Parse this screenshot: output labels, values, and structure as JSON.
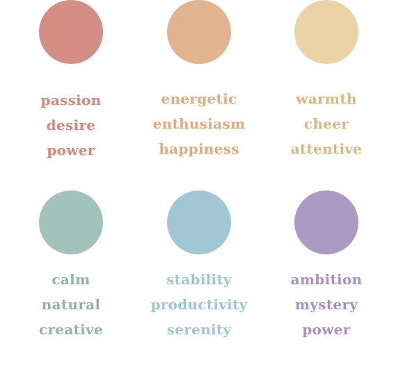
{
  "swatches": [
    {
      "color": "#d48e84",
      "text_color": "#dc8576",
      "words": [
        "passion",
        "desire",
        "power"
      ]
    },
    {
      "color": "#e0b48e",
      "text_color": "#e2aa7c",
      "words": [
        "energetic",
        "enthusiasm",
        "happiness"
      ]
    },
    {
      "color": "#ead2a6",
      "text_color": "#d8b87e",
      "words": [
        "warmth",
        "cheer",
        "attentive"
      ]
    },
    {
      "color": "#a2c3bb",
      "text_color": "#8db3aa",
      "words": [
        "calm",
        "natural",
        "creative"
      ]
    },
    {
      "color": "#a2c7d4",
      "text_color": "#9cc6d2",
      "words": [
        "stability",
        "productivity",
        "serenity"
      ]
    },
    {
      "color": "#ab9bc3",
      "text_color": "#a88fc3",
      "words": [
        "ambition",
        "mystery",
        "power"
      ]
    }
  ]
}
